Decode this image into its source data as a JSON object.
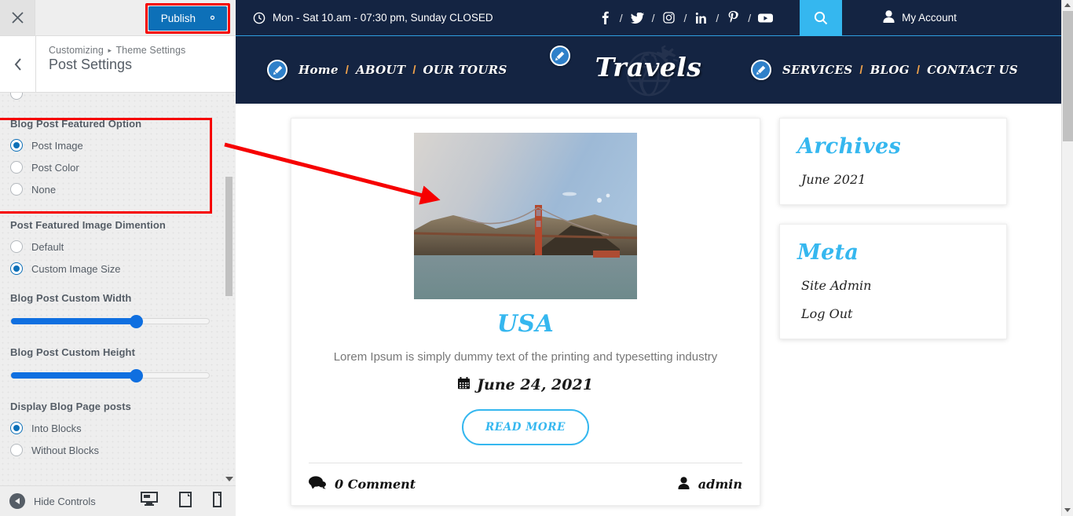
{
  "customizer": {
    "close_label": "×",
    "publish_label": "Publish",
    "gear_icon": "gear-icon",
    "back_label": "‹",
    "breadcrumb_root": "Customizing",
    "breadcrumb_sep": "▸",
    "breadcrumb_current": "Theme Settings",
    "panel_title": "Post Settings",
    "highlight_color": "#f60000",
    "accent_color": "#0d70b8",
    "controls": [
      {
        "label": "Blog Post Featured Option",
        "type": "radio",
        "options": [
          {
            "label": "Post Image",
            "selected": true
          },
          {
            "label": "Post Color",
            "selected": false
          },
          {
            "label": "None",
            "selected": false
          }
        ]
      },
      {
        "label": "Post Featured Image Dimention",
        "type": "radio",
        "options": [
          {
            "label": "Default",
            "selected": false
          },
          {
            "label": "Custom Image Size",
            "selected": true
          }
        ]
      },
      {
        "label": "Blog Post Custom Width",
        "type": "slider",
        "percent": 63
      },
      {
        "label": "Blog Post Custom Height",
        "type": "slider",
        "percent": 63
      },
      {
        "label": "Display Blog Page posts",
        "type": "radio",
        "options": [
          {
            "label": "Into Blocks",
            "selected": true
          },
          {
            "label": "Without Blocks",
            "selected": false
          }
        ]
      }
    ],
    "footer": {
      "hide_controls_label": "Hide Controls",
      "devices": [
        {
          "name": "desktop-preview-icon",
          "active": true
        },
        {
          "name": "tablet-preview-icon",
          "active": false
        },
        {
          "name": "mobile-preview-icon",
          "active": false
        }
      ]
    }
  },
  "site": {
    "topbar": {
      "hours": "Mon - Sat 10.am - 07:30 pm, Sunday CLOSED",
      "clock_icon": "clock-icon",
      "socials": [
        "facebook-icon",
        "twitter-icon",
        "instagram-icon",
        "linkedin-icon",
        "pinterest-icon",
        "youtube-icon"
      ],
      "separator": "/",
      "search_icon": "search-icon",
      "account_label": "My Account",
      "account_icon": "user-icon",
      "bg_color": "#142442",
      "search_bg": "#35b7ef"
    },
    "nav": {
      "left_links": [
        "Home",
        "ABOUT",
        "OUR TOURS"
      ],
      "right_links": [
        "SERVICES",
        "BLOG",
        "CONTACT US"
      ],
      "separator": "/",
      "brand": "Travels",
      "edit_icon": "pencil-edit-icon"
    },
    "post": {
      "featured_image_alt": "golden-gate-bridge-photo",
      "title": "USA",
      "excerpt": "Lorem Ipsum is simply dummy text of the printing and typesetting industry",
      "date": "June 24, 2021",
      "date_icon": "calendar-icon",
      "read_more_label": "READ MORE",
      "comment_count": "0 Comment",
      "comment_icon": "comments-icon",
      "author": "admin",
      "author_icon": "user-icon",
      "accent_color": "#35b7ef"
    },
    "widgets": [
      {
        "title": "Archives",
        "links": [
          "June 2021"
        ]
      },
      {
        "title": "Meta",
        "links": [
          "Site Admin",
          "Log Out"
        ]
      }
    ]
  }
}
